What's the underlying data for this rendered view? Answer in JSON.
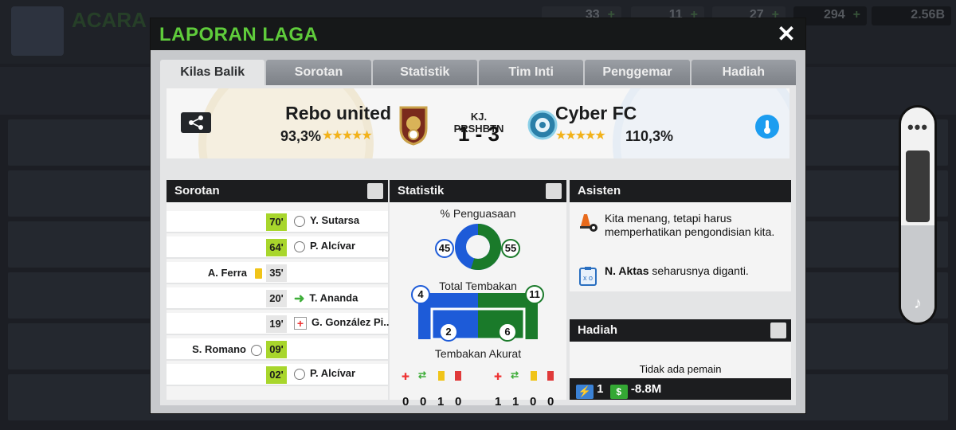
{
  "background": {
    "screen_title": "ACARA",
    "resources": [
      {
        "value": "33",
        "icon": "token-icon"
      },
      {
        "value": "11",
        "icon": "cash-pack-icon"
      },
      {
        "value": "27",
        "icon": "energy-icon"
      },
      {
        "value": "294",
        "icon": "medic-icon"
      },
      {
        "value": "2.56B",
        "icon": "money-icon"
      }
    ],
    "plus": "+"
  },
  "modal": {
    "title": "LAPORAN LAGA",
    "close": "✕",
    "tabs": [
      "Kilas Balik",
      "Sorotan",
      "Statistik",
      "Tim Inti",
      "Penggemar",
      "Hadiah"
    ],
    "active_tab": 0
  },
  "match": {
    "home_team": "Rebo united",
    "home_rating": "93,3%",
    "away_team": "Cyber FC",
    "away_rating": "110,3%",
    "label": "KJ. PRSHBTN",
    "score": "1 - 3"
  },
  "panels": {
    "sorotan_title": "Sorotan",
    "statistik_title": "Statistik",
    "asisten_title": "Asisten",
    "hadiah_title": "Hadiah"
  },
  "highlights": [
    {
      "minute": "70'",
      "side": "away",
      "player": "Y. Sutarsa",
      "event": "goal",
      "highlight": true
    },
    {
      "minute": "64'",
      "side": "away",
      "player": "P. Alcívar",
      "event": "goal",
      "highlight": true
    },
    {
      "minute": "35'",
      "side": "home",
      "player": "A. Ferra",
      "event": "yellow-card",
      "highlight": false
    },
    {
      "minute": "20'",
      "side": "away",
      "player": "T. Ananda",
      "event": "substitution",
      "highlight": false
    },
    {
      "minute": "19'",
      "side": "away",
      "player": "G. González Pi...",
      "event": "injury",
      "highlight": false
    },
    {
      "minute": "09'",
      "side": "home",
      "player": "S. Romano",
      "event": "goal",
      "highlight": true
    },
    {
      "minute": "02'",
      "side": "away",
      "player": "P. Alcívar",
      "event": "goal",
      "highlight": true
    }
  ],
  "stats": {
    "possession_label": "% Penguasaan",
    "possession_home": "45",
    "possession_away": "55",
    "shots_label": "Total Tembakan",
    "shots_home": "4",
    "shots_away": "11",
    "on_target_label": "Tembakan Akurat",
    "on_target_home": "2",
    "on_target_away": "6",
    "home_cards": [
      "0",
      "0",
      "1",
      "0"
    ],
    "away_cards": [
      "1",
      "1",
      "0",
      "0"
    ],
    "colors": {
      "home": "#1d5bd8",
      "away": "#1a7a2a"
    }
  },
  "assistant": {
    "msg1": "Kita menang, tetapi harus memperhatikan pengondisian kita.",
    "msg2_bold": "N. Aktas",
    "msg2_rest": " seharusnya diganti."
  },
  "rewards": {
    "empty_text": "Tidak ada pemain",
    "energy": "1",
    "money": "-8.8M"
  }
}
